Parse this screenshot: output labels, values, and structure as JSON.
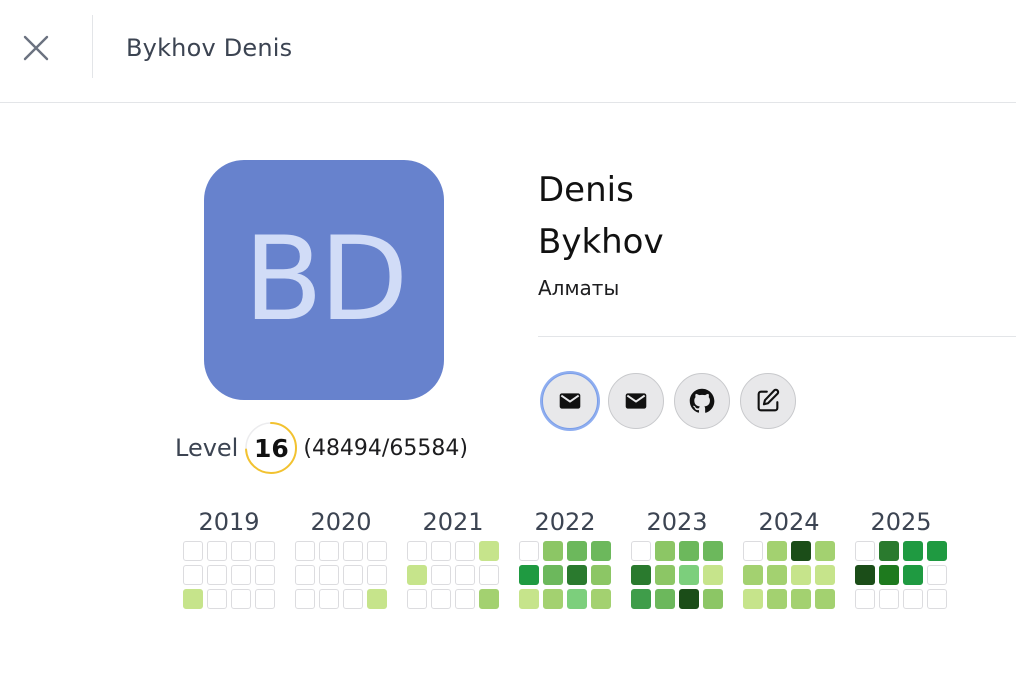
{
  "header": {
    "title": "Bykhov Denis",
    "close_icon": "close-icon"
  },
  "profile": {
    "initials": "BD",
    "avatar_color": "#6782cd",
    "first_name": "Denis",
    "last_name": "Bykhov",
    "city": "Алматы"
  },
  "level": {
    "label": "Level",
    "number": "16",
    "xp": "(48494/65584)",
    "progress_fraction": 0.739
  },
  "contacts": [
    {
      "icon": "mail-icon",
      "active": true
    },
    {
      "icon": "mail-icon",
      "active": false
    },
    {
      "icon": "github-icon",
      "active": false
    },
    {
      "icon": "edit-icon",
      "active": false
    }
  ],
  "activity": {
    "years": [
      {
        "year": "2019",
        "cells": [
          0,
          0,
          0,
          0,
          0,
          0,
          0,
          0,
          1,
          0,
          0,
          0
        ]
      },
      {
        "year": "2020",
        "cells": [
          0,
          0,
          0,
          0,
          0,
          0,
          0,
          0,
          0,
          0,
          0,
          1
        ]
      },
      {
        "year": "2021",
        "cells": [
          0,
          0,
          0,
          1,
          1,
          0,
          0,
          0,
          0,
          0,
          0,
          2
        ]
      },
      {
        "year": "2022",
        "cells": [
          0,
          3,
          4,
          4,
          6,
          4,
          7,
          3,
          1,
          2,
          9,
          2
        ]
      },
      {
        "year": "2023",
        "cells": [
          0,
          3,
          4,
          4,
          7,
          3,
          9,
          1,
          5,
          4,
          8,
          3
        ]
      },
      {
        "year": "2024",
        "cells": [
          0,
          2,
          8,
          2,
          2,
          2,
          1,
          1,
          1,
          2,
          2,
          2
        ]
      },
      {
        "year": "2025",
        "cells": [
          0,
          7,
          6,
          6,
          8,
          10,
          6,
          0,
          0,
          0,
          0,
          0
        ]
      }
    ]
  }
}
